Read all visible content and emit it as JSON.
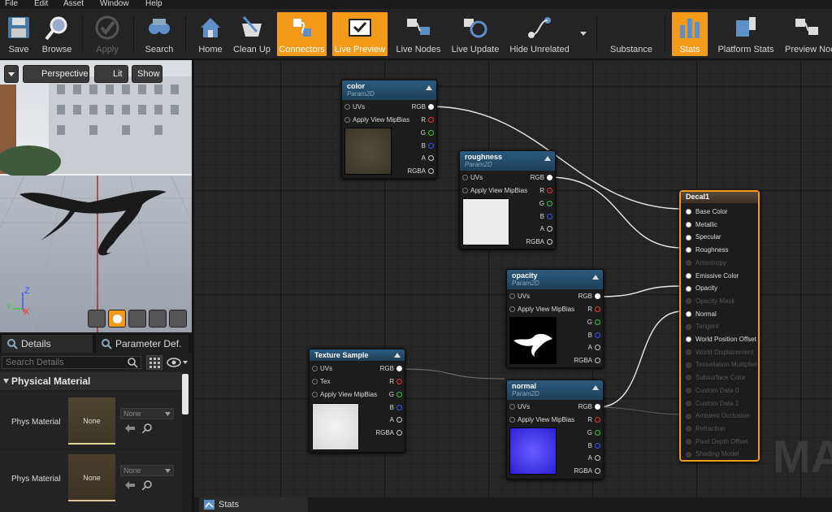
{
  "menu": [
    "File",
    "Edit",
    "Asset",
    "Window",
    "Help"
  ],
  "toolbar": [
    {
      "label": "Save",
      "icon": "save-icon"
    },
    {
      "label": "Browse",
      "icon": "browse-icon"
    },
    {
      "label": "Apply",
      "icon": "apply-icon",
      "disabled": true
    },
    {
      "label": "Search",
      "icon": "search-icon"
    },
    {
      "label": "Home",
      "icon": "home-icon"
    },
    {
      "label": "Clean Up",
      "icon": "clean-up-icon"
    },
    {
      "label": "Connectors",
      "icon": "connectors-icon",
      "active": true
    },
    {
      "label": "Live Preview",
      "icon": "live-preview-icon",
      "active": true
    },
    {
      "label": "Live Nodes",
      "icon": "live-nodes-icon"
    },
    {
      "label": "Live Update",
      "icon": "live-update-icon"
    },
    {
      "label": "Hide Unrelated",
      "icon": "hide-unrelated-icon"
    },
    {
      "label": "Substance",
      "icon": "substance-icon"
    },
    {
      "label": "Stats",
      "icon": "stats-icon",
      "active": true
    },
    {
      "label": "Platform Stats",
      "icon": "platform-stats-icon"
    },
    {
      "label": "Preview Nod",
      "icon": "preview-nodes-icon"
    }
  ],
  "viewport": {
    "perspective": "Perspective",
    "lit": "Lit",
    "show": "Show",
    "axis_z": "Z",
    "axis_x": "X",
    "axis_y": "Y"
  },
  "details": {
    "tab_details": "Details",
    "tab_params": "Parameter Def.",
    "search_placeholder": "Search Details",
    "section": "Physical Material",
    "rows": [
      {
        "label": "Phys Material",
        "thumb": "None",
        "value": "None"
      },
      {
        "label": "Phys Material I",
        "thumb": "None",
        "value": "None"
      }
    ]
  },
  "nodes": {
    "color": {
      "title": "color",
      "sub": "Param2D"
    },
    "roughness": {
      "title": "roughness",
      "sub": "Param2D"
    },
    "opacity": {
      "title": "opacity",
      "sub": "Param2D"
    },
    "normal": {
      "title": "normal",
      "sub": "Param2D"
    },
    "texture": {
      "title": "Texture Sample"
    },
    "pins": {
      "uvs": "UVs",
      "mip": "Apply View MipBias",
      "tex": "Tex",
      "rgb": "RGB",
      "r": "R",
      "g": "G",
      "b": "B",
      "a": "A",
      "rgba": "RGBA"
    }
  },
  "material_node": {
    "title": "Decal1",
    "inputs": [
      {
        "label": "Base Color",
        "on": true
      },
      {
        "label": "Metallic",
        "on": true
      },
      {
        "label": "Specular",
        "on": true
      },
      {
        "label": "Roughness",
        "on": true
      },
      {
        "label": "Anisotropy",
        "on": false
      },
      {
        "label": "Emissive Color",
        "on": true
      },
      {
        "label": "Opacity",
        "on": true
      },
      {
        "label": "Opacity Mask",
        "on": false
      },
      {
        "label": "Normal",
        "on": true
      },
      {
        "label": "Tangent",
        "on": false
      },
      {
        "label": "World Position Offset",
        "on": true
      },
      {
        "label": "World Displacement",
        "on": false
      },
      {
        "label": "Tessellation Multiplier",
        "on": false
      },
      {
        "label": "Subsurface Color",
        "on": false
      },
      {
        "label": "Custom Data 0",
        "on": false
      },
      {
        "label": "Custom Data 1",
        "on": false
      },
      {
        "label": "Ambient Occlusion",
        "on": false
      },
      {
        "label": "Refraction",
        "on": false
      },
      {
        "label": "Pixel Depth Offset",
        "on": false
      },
      {
        "label": "Shading Model",
        "on": false
      }
    ]
  },
  "watermark": "MAT",
  "stats_tab": "Stats",
  "colors": {
    "accent": "#f39a1a",
    "node_header": "#2b5a7e",
    "pin_r": "#e33",
    "pin_g": "#3c3",
    "pin_b": "#35f"
  }
}
